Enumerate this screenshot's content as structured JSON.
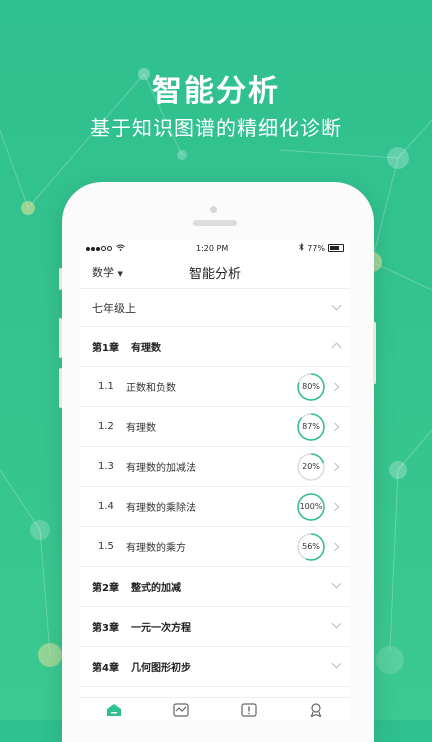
{
  "hero": {
    "title": "智能分析",
    "subtitle": "基于知识图谱的精细化诊断"
  },
  "colors": {
    "accent": "#2fc08f",
    "ring_track": "#dcdcdc"
  },
  "status_bar": {
    "carrier_signal": "●●●○○",
    "time": "1:20 PM",
    "battery": "77%"
  },
  "nav": {
    "subject": "数学",
    "title": "智能分析"
  },
  "grade": {
    "label": "七年级上"
  },
  "chapters": [
    {
      "num": "第1章",
      "name": "有理数",
      "expanded": true
    },
    {
      "num": "第2章",
      "name": "整式的加减",
      "expanded": false
    },
    {
      "num": "第3章",
      "name": "一元一次方程",
      "expanded": false
    },
    {
      "num": "第4章",
      "name": "几何图形初步",
      "expanded": false
    }
  ],
  "sections": [
    {
      "num": "1.1",
      "name": "正数和负数",
      "progress": 80,
      "progress_label": "80%"
    },
    {
      "num": "1.2",
      "name": "有理数",
      "progress": 87,
      "progress_label": "87%"
    },
    {
      "num": "1.3",
      "name": "有理数的加减法",
      "progress": 20,
      "progress_label": "20%"
    },
    {
      "num": "1.4",
      "name": "有理数的乘除法",
      "progress": 100,
      "progress_label": "100%"
    },
    {
      "num": "1.5",
      "name": "有理数的乘方",
      "progress": 56,
      "progress_label": "56%"
    }
  ],
  "tabbar": {
    "icons": [
      "home-icon",
      "analysis-icon",
      "notebook-icon",
      "profile-icon"
    ],
    "active": 0
  }
}
